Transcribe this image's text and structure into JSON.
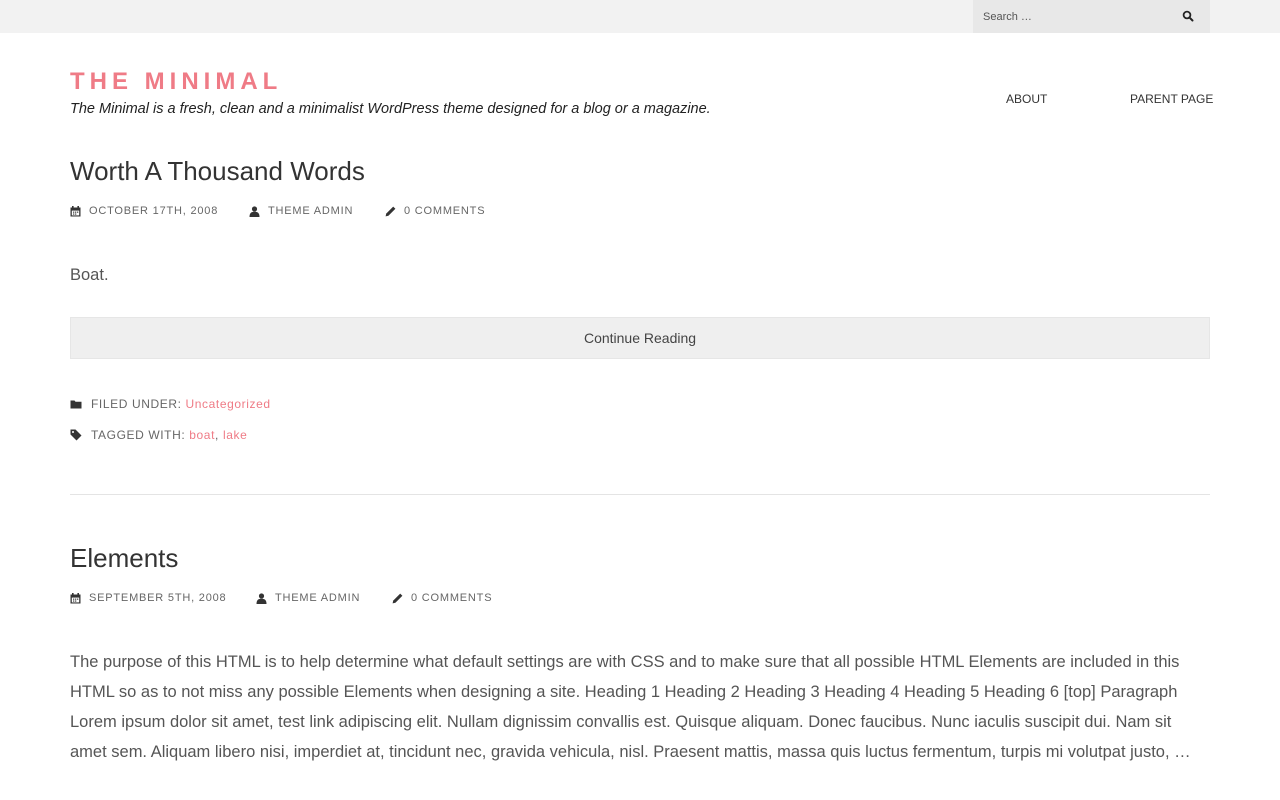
{
  "colors": {
    "accent": "#ef7b86",
    "top_bar": "#f2f2f2",
    "button_bg": "#efefef"
  },
  "search": {
    "placeholder": "Search …",
    "icon": "search-icon"
  },
  "site": {
    "title": "THE MINIMAL",
    "description": "The Minimal is a fresh, clean and a minimalist WordPress theme designed for a blog or a magazine."
  },
  "nav": {
    "items": [
      {
        "label": "ABOUT"
      },
      {
        "label": "PARENT PAGE"
      }
    ]
  },
  "posts": [
    {
      "title": "Worth A Thousand Words",
      "date": "OCTOBER 17TH, 2008",
      "author": "THEME ADMIN",
      "comments": "0 COMMENTS",
      "excerpt": "Boat.",
      "continue_label": "Continue Reading",
      "filed_under_label": "FILED UNDER:",
      "category": "Uncategorized",
      "tagged_with_label": "TAGGED WITH:",
      "tags": [
        "boat",
        "lake"
      ]
    },
    {
      "title": "Elements",
      "date": "SEPTEMBER 5TH, 2008",
      "author": "THEME ADMIN",
      "comments": "0 COMMENTS",
      "excerpt": "The purpose of this HTML is to help determine what default settings are with CSS and to make sure that all possible HTML Elements are included in this HTML so as to not miss any possible Elements when designing a site. Heading 1 Heading 2 Heading 3 Heading 4 Heading 5 Heading 6 [top] Paragraph Lorem ipsum dolor sit amet, test link adipiscing elit. Nullam dignissim convallis est. Quisque aliquam. Donec faucibus. Nunc iaculis suscipit dui. Nam sit amet sem. Aliquam libero nisi, imperdiet at, tincidunt nec, gravida vehicula, nisl. Praesent mattis, massa quis luctus fermentum, turpis mi volutpat justo, …"
    }
  ]
}
